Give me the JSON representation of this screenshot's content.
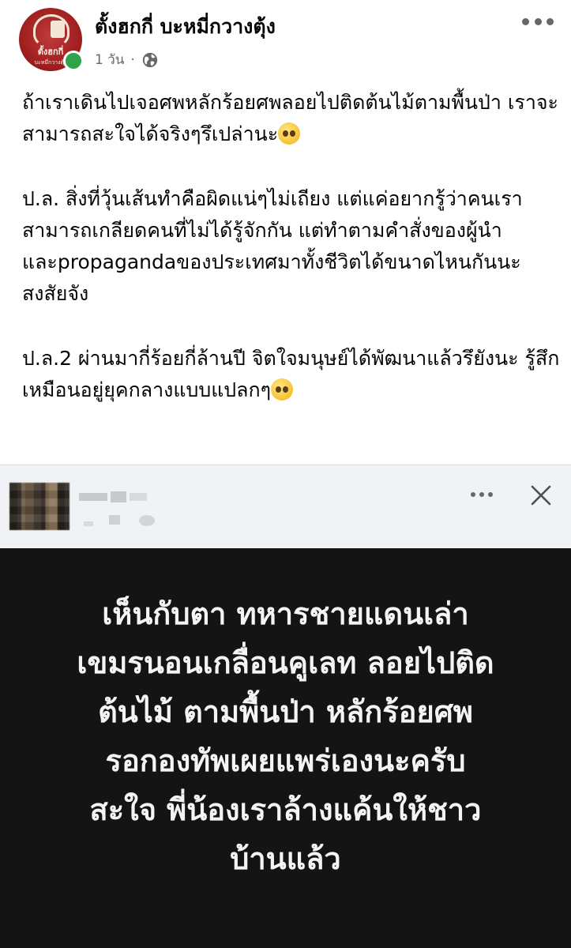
{
  "post": {
    "page_name": "ตั้งฮกกี่ บะหมี่กวางตุ้ง",
    "time": "1 วัน",
    "separator": "·",
    "visibility_icon": "globe-icon",
    "more_icon": "more-options-icon",
    "avatar_logo_text": "ตั้งฮกกี่",
    "avatar_logo_sub": "บะหมี่กวางตุ้ง",
    "paragraphs": [
      {
        "text": "ถ้าเราเดินไปเจอศพหลักร้อยศพลอยไปติดต้นไม้ตามพื้นป่า เราจะสามารถสะใจได้จริงๆรึเปล่านะ",
        "emoji": "pleading-face-emoji"
      },
      {
        "text": "ป.ล. สิ่งที่วุ้นเส้นทำคือผิดแน่ๆไม่เถียง แต่แค่อยากรู้ว่าคนเราสามารถเกลียดคนที่ไม่ได้รู้จักกัน แต่ทำตามคำสั่งของผู้นำและpropagandaของประเทศมาทั้งชีวิตได้ขนาดไหนกันนะ สงสัยจัง",
        "emoji": ""
      },
      {
        "text": "ป.ล.2 ผ่านมากี่ร้อยกี่ล้านปี จิตใจมนุษย์ได้พัฒนาแล้วรึยังนะ รู้สึกเหมือนอยู่ยุคกลางแบบแปลกๆ",
        "emoji": "pleading-face-emoji"
      }
    ]
  },
  "shared": {
    "author_name": "",
    "more_icon": "more-options-icon",
    "close_icon": "close-icon",
    "quote_text": "เห็นกับตา ทหารชายแดนเล่า\nเขมรนอนเกลื่อนคูเลท ลอยไปติด\nต้นไม้ ตามพื้นป่า หลักร้อยศพ\nรอกองทัพเผยแพร่เองนะครับ\nสะใจ พี่น้องเราล้างแค้นให้ชาว\nบ้านแล้ว"
  },
  "colors": {
    "online": "#31a24c",
    "meta_text": "#65676b",
    "quote_bg": "#141414",
    "quote_text": "#f4f4f4"
  }
}
